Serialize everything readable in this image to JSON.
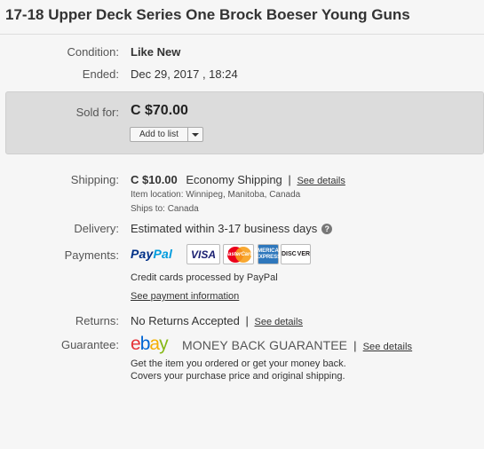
{
  "title": "17-18 Upper Deck Series One Brock Boeser Young Guns",
  "condition": {
    "label": "Condition:",
    "value": "Like New"
  },
  "ended": {
    "label": "Ended:",
    "value": "Dec 29, 2017 , 18:24"
  },
  "sold": {
    "label": "Sold for:",
    "price": "C $70.00",
    "add_to_list": "Add to list"
  },
  "shipping": {
    "label": "Shipping:",
    "cost": "C $10.00",
    "method": "Economy Shipping",
    "separator": "|",
    "see_details": "See details",
    "item_location": "Item location:  Winnipeg, Manitoba, Canada",
    "ships_to": "Ships to:  Canada"
  },
  "delivery": {
    "label": "Delivery:",
    "value": "Estimated within 3-17 business days",
    "help": "?"
  },
  "payments": {
    "label": "Payments:",
    "paypal_pay": "Pay",
    "paypal_pal": "Pal",
    "visa": "VISA",
    "mastercard": "MasterCard",
    "amex_line1": "AMERICAN",
    "amex_line2": "EXPRESS",
    "discover_a": "DISC",
    "discover_b": "VER",
    "note": "Credit cards processed by PayPal",
    "see_info": "See payment information"
  },
  "returns": {
    "label": "Returns:",
    "value": "No Returns Accepted",
    "separator": "|",
    "see_details": "See details"
  },
  "guarantee": {
    "label": "Guarantee:",
    "ebay": [
      "e",
      "b",
      "a",
      "y"
    ],
    "text": "MONEY BACK GUARANTEE",
    "separator": "|",
    "see_details": "See details",
    "line1": "Get the item you ordered or get your money back.",
    "line2": "Covers your purchase price and original shipping."
  },
  "colors": {
    "paypal_dark": "#003087",
    "paypal_light": "#009cde",
    "panel": "#dcdcdc"
  }
}
